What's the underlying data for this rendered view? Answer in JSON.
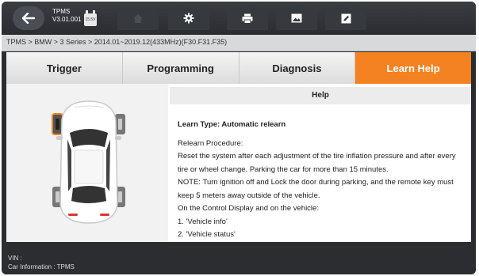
{
  "toolbar": {
    "app_name": "TPMS",
    "app_version": "V3.01.001",
    "battery_voltage": "15.5V",
    "icons": [
      "home-icon",
      "settings-icon",
      "print-icon",
      "image-icon",
      "edit-icon"
    ]
  },
  "breadcrumb": "TPMS > BMW > 3 Series > 2014.01~2019.12(433MHz)(F30.F31.F35)",
  "tabs": [
    {
      "label": "Trigger"
    },
    {
      "label": "Programming"
    },
    {
      "label": "Diagnosis"
    },
    {
      "label": "Learn Help"
    }
  ],
  "active_tab": "Learn Help",
  "help": {
    "header": "Help",
    "learn_type": "Learn Type:  Automatic relearn",
    "lines": [
      "Relearn Procedure:",
      "Reset the system after each adjustment of the tire inflation pressure and after every tire or wheel change. Parking the car for more than 15 minutes.",
      "NOTE: Turn ignition off and Lock the door during parking, and the remote key must keep 5 meters away outside of the vehicle.",
      "On the Control Display and on the vehicle:",
      "1. 'Vehicle info'",
      "2. 'Vehicle status'"
    ]
  },
  "footer": {
    "vin": "VIN :",
    "car_info": "Car Information : TPMS"
  },
  "colors": {
    "accent": "#f58220",
    "sensor_highlight": "#f58220"
  }
}
